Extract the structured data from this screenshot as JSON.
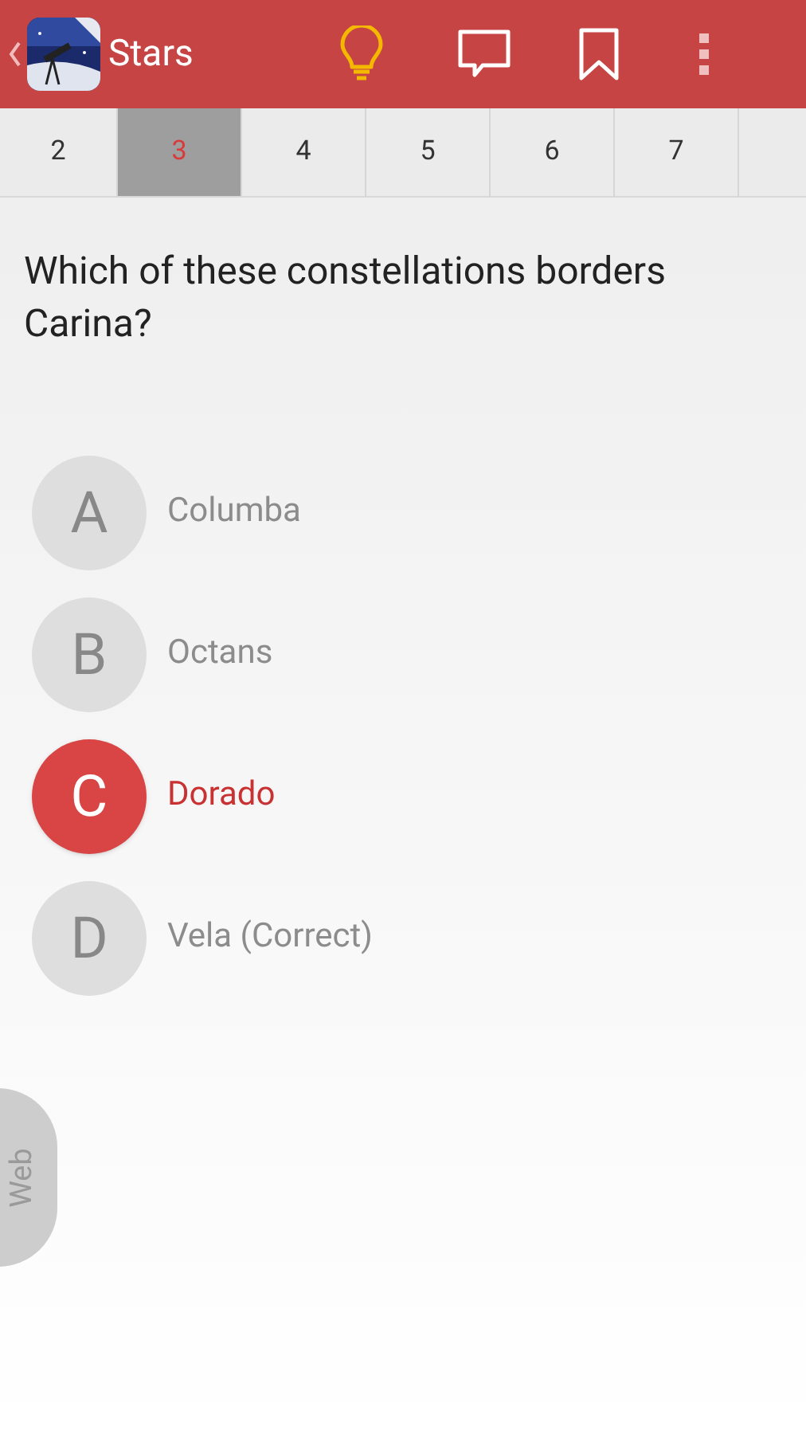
{
  "app_bar": {
    "title": "Stars"
  },
  "question_tabs": [
    {
      "label": "2",
      "selected": false
    },
    {
      "label": "3",
      "selected": true
    },
    {
      "label": "4",
      "selected": false
    },
    {
      "label": "5",
      "selected": false
    },
    {
      "label": "6",
      "selected": false
    },
    {
      "label": "7",
      "selected": false
    }
  ],
  "question": "Which of these constellations borders Carina?",
  "answers": [
    {
      "letter": "A",
      "text": "Columba",
      "selected": false
    },
    {
      "letter": "B",
      "text": "Octans",
      "selected": false
    },
    {
      "letter": "C",
      "text": "Dorado",
      "selected": true
    },
    {
      "letter": "D",
      "text": "Vela (Correct)",
      "selected": false
    }
  ],
  "side_tab": {
    "label": "Web"
  }
}
